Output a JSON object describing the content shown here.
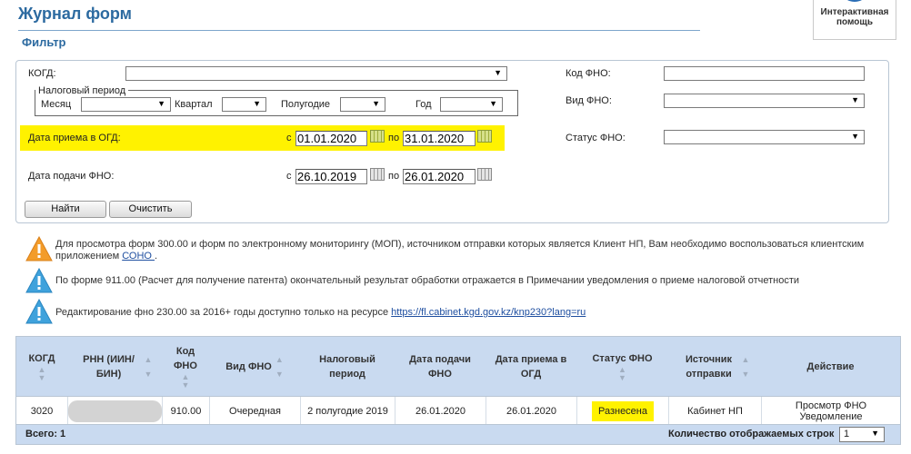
{
  "page": {
    "title": "Журнал форм",
    "filter_title": "Фильтр",
    "help_label": "Интерактивная помощь"
  },
  "filter": {
    "kogd_label": "КОГД:",
    "kogd_value": "",
    "tax_period": {
      "legend": "Налоговый период",
      "month_label": "Месяц",
      "month_value": "",
      "quarter_label": "Квартал",
      "quarter_value": "",
      "halfyear_label": "Полугодие",
      "halfyear_value": "",
      "year_label": "Год",
      "year_value": ""
    },
    "receipt_date": {
      "label": "Дата приема в ОГД:",
      "from_label": "с",
      "from": "01.01.2020",
      "to_label": "по",
      "to": "31.01.2020"
    },
    "submit_date": {
      "label": "Дата подачи ФНО:",
      "from_label": "с",
      "from": "26.10.2019",
      "to_label": "по",
      "to": "26.01.2020"
    },
    "kod_fno_label": "Код ФНО:",
    "kod_fno_value": "",
    "vid_fno_label": "Вид ФНО:",
    "vid_fno_value": "",
    "status_fno_label": "Статус ФНО:",
    "status_fno_value": "",
    "find_button": "Найти",
    "clear_button": "Очистить"
  },
  "notices": [
    {
      "text_1": "Для просмотра форм 300.00 и форм по электронному мониторингу (МОП), источником отправки которых является Клиент НП, Вам необходимо воспользоваться клиентским приложением ",
      "link": "СОНО ",
      "text_2": "."
    },
    {
      "text": "По форме 911.00 (Расчет для получение патента) окончательный результат обработки отражается в Примечании уведомления о приеме налоговой отчетности"
    },
    {
      "text": "Редактирование фно 230.00 за 2016+ годы доступно только на ресурсе ",
      "link": "https://fl.cabinet.kgd.gov.kz/knp230?lang=ru"
    }
  ],
  "table": {
    "headers": [
      "КОГД",
      "РНН (ИИН/ БИН)",
      "Код ФНО",
      "Вид ФНО",
      "Налоговый период",
      "Дата подачи ФНО",
      "Дата приема в ОГД",
      "Статус ФНО",
      "Источник отправки",
      "Действие"
    ],
    "rows": [
      {
        "kogd": "3020",
        "rnn": "",
        "kod_fno": "910.00",
        "vid_fno": "Очередная",
        "period": "2 полугодие 2019",
        "submit_date": "26.01.2020",
        "receipt_date": "26.01.2020",
        "status": "Разнесена",
        "source": "Кабинет НП",
        "action_1": "Просмотр ФНО",
        "action_2": "Уведомление"
      }
    ],
    "total": "Всего: 1",
    "rows_count_label": "Количество отображаемых строк",
    "rows_count_value": "1"
  }
}
